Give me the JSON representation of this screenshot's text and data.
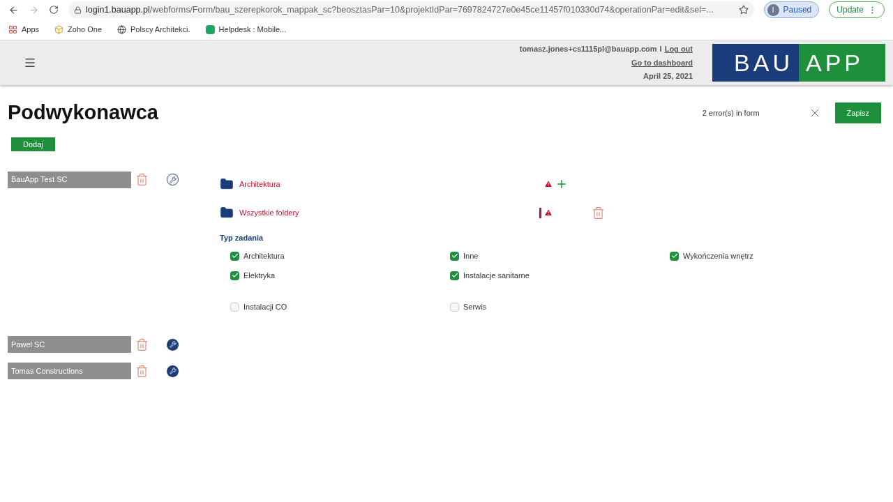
{
  "browser": {
    "url_host": "login1.bauapp.pl",
    "url_path": "/webforms/Form/bau_szerepkorok_mappak_sc?beosztasPar=10&projektIdPar=7697824727e0e45ce11457f010330d74&operationPar=edit&sel=...",
    "profile_initial": "I",
    "profile_label": "Paused",
    "update_label": "Update"
  },
  "bookmarks": [
    {
      "label": "Apps",
      "kind": "apps"
    },
    {
      "label": "Zoho One",
      "kind": "zoho"
    },
    {
      "label": "Polscy Architekci.",
      "kind": "globe"
    },
    {
      "label": "Helpdesk : Mobile...",
      "kind": "helpdesk"
    }
  ],
  "header": {
    "user_email": "tomasz.jones+cs1115pl@bauapp.com",
    "separator": "I",
    "logout": "Log out",
    "dashboard": "Go to dashboard",
    "date": "April 25, 2021",
    "logo_left": "BAU",
    "logo_right": "APP"
  },
  "page": {
    "title": "Podwykonawca",
    "errors": "2 error(s) in form",
    "save": "Zapisz",
    "add": "Dodaj"
  },
  "subcontractors": [
    {
      "name": "BauApp Test SC",
      "expanded": true
    },
    {
      "name": "Pawel SC",
      "expanded": false
    },
    {
      "name": "Tomas Constructions",
      "expanded": false
    }
  ],
  "folders": [
    {
      "name": "Architektura",
      "error": true,
      "kind": "add"
    },
    {
      "name": "Wszystkie foldery",
      "error": true,
      "kind": "remove"
    }
  ],
  "task_types": {
    "title": "Typ zadania",
    "columns": [
      [
        {
          "label": "Architektura",
          "checked": true
        },
        {
          "label": "Elektryka",
          "checked": true
        },
        {
          "label": "Instalacji CO",
          "checked": false
        }
      ],
      [
        {
          "label": "Inne",
          "checked": true
        },
        {
          "label": "Instalacje sanitarne",
          "checked": true
        },
        {
          "label": "Serwis",
          "checked": false
        }
      ],
      [
        {
          "label": "Wykończenia wnętrz",
          "checked": true
        }
      ]
    ]
  }
}
